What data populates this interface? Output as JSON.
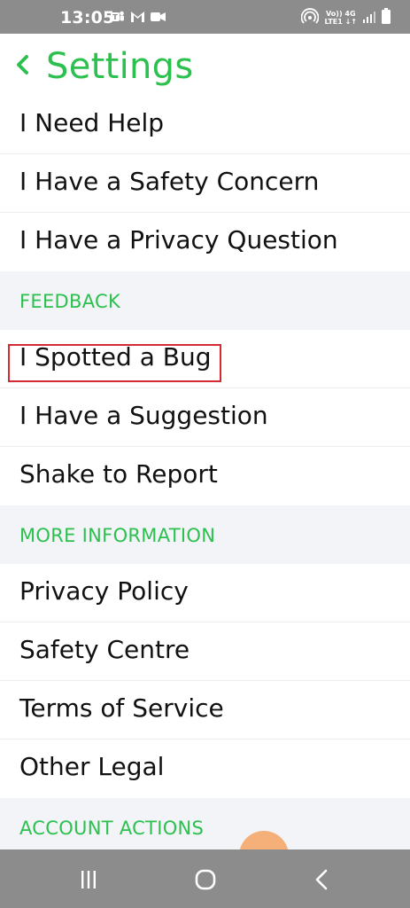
{
  "status_bar": {
    "time": "13:05",
    "network_top": "Vo)) 4G",
    "network_bottom": "LTE1 ↓↑"
  },
  "header": {
    "title": "Settings"
  },
  "list": [
    {
      "type": "item",
      "label": "I Need Help"
    },
    {
      "type": "item",
      "label": "I Have a Safety Concern"
    },
    {
      "type": "item",
      "label": "I Have a Privacy Question"
    },
    {
      "type": "section",
      "label": "FEEDBACK"
    },
    {
      "type": "item",
      "label": "I Spotted a Bug"
    },
    {
      "type": "item",
      "label": "I Have a Suggestion"
    },
    {
      "type": "item",
      "label": "Shake to Report"
    },
    {
      "type": "section",
      "label": "MORE INFORMATION"
    },
    {
      "type": "item",
      "label": "Privacy Policy"
    },
    {
      "type": "item",
      "label": "Safety Centre"
    },
    {
      "type": "item",
      "label": "Terms of Service"
    },
    {
      "type": "item",
      "label": "Other Legal"
    },
    {
      "type": "section",
      "label": "ACCOUNT ACTIONS"
    }
  ],
  "colors": {
    "accent": "#2cc04f",
    "highlight": "#d32a34",
    "section_bg": "#f2f4f7",
    "system_bar": "#8c8c8c"
  },
  "icons": {
    "back": "chevron-left-icon",
    "nav_recent": "recent-apps-icon",
    "nav_home": "home-icon",
    "nav_back": "back-icon"
  }
}
